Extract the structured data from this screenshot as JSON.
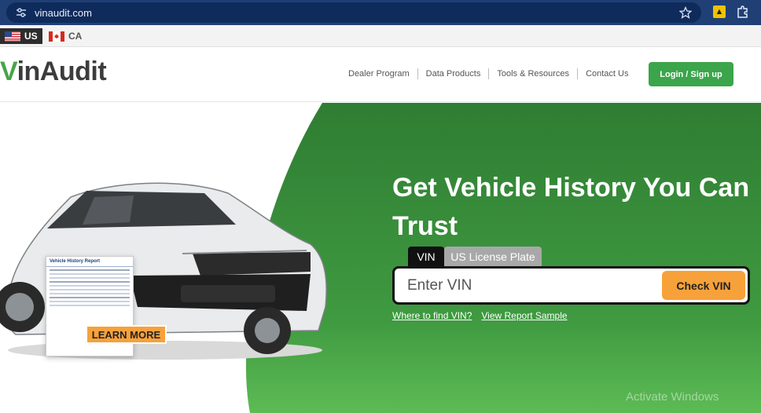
{
  "browser": {
    "url": "vinaudit.com"
  },
  "country_bar": {
    "us_label": "US",
    "ca_label": "CA"
  },
  "header": {
    "logo_v": "V",
    "logo_rest": "inAudit",
    "nav": [
      "Dealer Program",
      "Data Products",
      "Tools & Resources",
      "Contact Us"
    ],
    "login_label": "Login / Sign up"
  },
  "hero": {
    "headline": "Get Vehicle History You Can Trust",
    "tab_vin": "VIN",
    "tab_plate": "US License Plate",
    "vin_placeholder": "Enter VIN",
    "check_label": "Check VIN",
    "link_where": "Where to find VIN?",
    "link_sample": "View Report Sample",
    "learn_more": "LEARN MORE",
    "report_title": "Vehicle History Report",
    "watermark": "Activate Windows"
  },
  "colors": {
    "brand_green": "#3aa54a",
    "accent_orange": "#f7a13a",
    "browser_blue": "#1f3f75"
  }
}
